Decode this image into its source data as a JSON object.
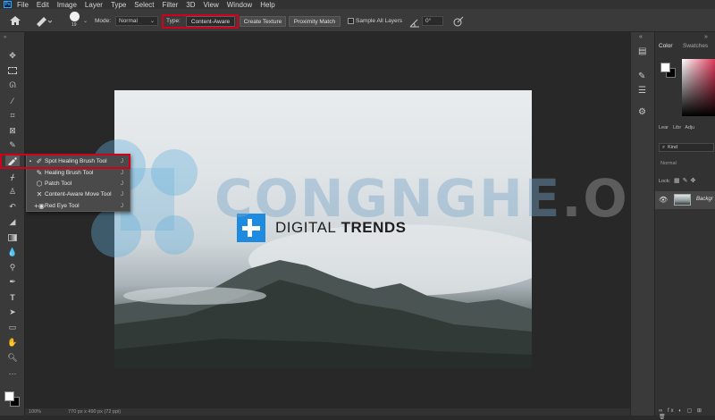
{
  "menu": {
    "logo": "Ps",
    "items": [
      "File",
      "Edit",
      "Image",
      "Layer",
      "Type",
      "Select",
      "Filter",
      "3D",
      "View",
      "Window",
      "Help"
    ]
  },
  "options": {
    "brush_size": "19",
    "mode_label": "Mode:",
    "mode_value": "Normal",
    "type_label": "Type:",
    "type_buttons": [
      "Content-Aware",
      "Create Texture",
      "Proximity Match"
    ],
    "sample_all_layers": "Sample All Layers",
    "angle_value": "0°"
  },
  "flyout": {
    "items": [
      {
        "label": "Spot Healing Brush Tool",
        "key": "J",
        "selected": true
      },
      {
        "label": "Healing Brush Tool",
        "key": "J"
      },
      {
        "label": "Patch Tool",
        "key": "J"
      },
      {
        "label": "Content-Aware Move Tool",
        "key": "J"
      },
      {
        "label": "Red Eye Tool",
        "key": "J"
      }
    ]
  },
  "document": {
    "logo_brand_bold": "DIGITAL",
    "logo_brand_light": " TRENDS"
  },
  "watermark": {
    "main": "CONGNGHE",
    "suffix": ".ORG"
  },
  "panels": {
    "tab_color": "Color",
    "tab_swatches": "Swatches",
    "layers_tabs": [
      "Lear",
      "Libr",
      "Adju"
    ],
    "kind_label": "Kind",
    "blend_mode": "Normal",
    "lock_label": "Lock:",
    "layer_name": "Backgr"
  },
  "status": {
    "zoom": "100%",
    "doc_info": "770 px x 490 px (72 ppi)"
  },
  "colors": {
    "highlight_red": "#d0021b",
    "accent_blue": "#31a8ff"
  }
}
